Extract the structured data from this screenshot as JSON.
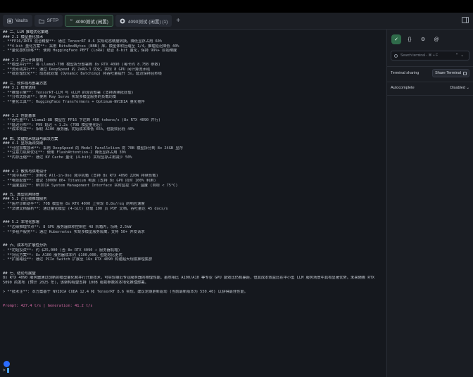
{
  "tabs": [
    {
      "label": "Vaults",
      "icon": "vault-icon"
    },
    {
      "label": "SFTP",
      "icon": "folder-icon"
    },
    {
      "label": "4090测试 (闲置)",
      "icon": "server-icon",
      "active": true
    },
    {
      "label": "4090测试 (闲置) (1)",
      "icon": "server-icon"
    }
  ],
  "terminal": {
    "lines": [
      {
        "t": "## 二、LLM 推理优化策略",
        "c": "h2"
      },
      {
        "t": "### 2.1 模型量化技术",
        "c": "h3"
      },
      {
        "t": "- **FP16/INT8 混合精度**: 通过 TensorRT 8.6 实现动态精度转换，降低显存占用 60%"
      },
      {
        "t": "- **4-bit 量化方案**: 采用 BitsAndBytes (BNB) 库，模型体积压缩至 1/4，推理延迟降低 40%"
      },
      {
        "t": "- **量化感知训练**: 使用 HuggingFace PEFT (LoRA) 结合 8-bit 量化，保持 99%+ 原始精度"
      },
      {
        "t": "",
        "c": "blank"
      },
      {
        "t": "### 2.2 并行计算架构",
        "c": "h3"
      },
      {
        "t": "- **模型并行**: 将 Llama3-70B 模型拆分部署到 8x RTX 4090 (每卡约 8.75B 参数)"
      },
      {
        "t": "- **流水线并行**: 通过 DeepSpeed 的 ZeRO-3 优化，实现 8 GPU 间计算流水线"
      },
      {
        "t": "- **批处理优化**: 动态批处理 (Dynamic Batching) 将吞吐量提升 3x，延迟保持且秒级"
      },
      {
        "t": "",
        "c": "blank"
      },
      {
        "t": "## 三、软件栈与部署方案",
        "c": "h2"
      },
      {
        "t": "### 3.1 框架选择",
        "c": "h3"
      },
      {
        "t": "- **推理引擎**: TensorRT-LLM 与 vLLM 的混合部署 (支持连续批处理)"
      },
      {
        "t": "- **分布式协调**: 使用 Ray Serve 实现多模型服务的负载均衡"
      },
      {
        "t": "- **量化工具**: HuggingFace Transformers + Optimum-NVIDIA 量化插件"
      },
      {
        "t": "",
        "c": "blank"
      },
      {
        "t": "",
        "c": "blank"
      },
      {
        "t": "### 3.2 性能基准",
        "c": "h3"
      },
      {
        "t": "- **吞吐量**: Llama3-8B 模型在 FP16 下达到 450 tokens/s (8x RTX 4090 并行)"
      },
      {
        "t": "- **延迟分布**: P99 延迟 < 1.2s (70B 模型量化后)"
      },
      {
        "t": "- **成本效益**: 相较 A100 服务器，初始成本降低 65%，但能效比低 40%"
      },
      {
        "t": "",
        "c": "blank"
      },
      {
        "t": "## 四、关键技术挑战与解决方案",
        "c": "h2"
      },
      {
        "t": "### 4.1 显存瓶颈突破",
        "c": "h3"
      },
      {
        "t": "- **分层加载技术**: 采用 DeepSpeed 的 Model Parallelism 将 70B 模型拆分到 8x 24GB 显存"
      },
      {
        "t": "- **注意力机制优化**: 使用 FlashAttention-2 降低显存占用 30%"
      },
      {
        "t": "- **内存压缩**: 通过 KV Cache 量化 (4-bit) 实现显存占用减少 50%"
      },
      {
        "t": "",
        "c": "blank"
      },
      {
        "t": "",
        "c": "blank"
      },
      {
        "t": "### 4.2 散热与供电设计",
        "c": "h3"
      },
      {
        "t": "- **液冷系统**: 定制化 All-in-One 液冷机箱 (支持 8x RTX 4090 220W 持续负载)"
      },
      {
        "t": "- **电源配置**: 建议 3000W 80+ Titanium 电源 (支持 8x GPU 同时 100% 利用)"
      },
      {
        "t": "- **温度监控**: NVIDIA System Management Interface 实时监控 GPU 温度 (目标 < 75°C)"
      },
      {
        "t": "",
        "c": "blank"
      },
      {
        "t": "## 五、典型应用场景",
        "c": "h2"
      },
      {
        "t": "### 5.1 企业级推理服务",
        "c": "h3"
      },
      {
        "t": "- **医疗诊断助手**: 70B 模型在 8x RTX 4090 上实现 0.8s/req 的响应速度"
      },
      {
        "t": "- **法律文档解析**: 通过量化模型 (4-bit) 处理 100 页 PDF 文档，吞吐量达 45 docs/s"
      },
      {
        "t": "",
        "c": "blank"
      },
      {
        "t": "",
        "c": "blank"
      },
      {
        "t": "### 5.2 本地化部署",
        "c": "h3"
      },
      {
        "t": "- **边缘推理节点**: 8 GPU 服务器体积控制在 4U 机箱内，功耗 2.5kW"
      },
      {
        "t": "- **多租户服务**: 通过 Kubernetes 实现多模型服务隔离，支持 50+ 并发请求"
      },
      {
        "t": "",
        "c": "blank"
      },
      {
        "t": "",
        "c": "blank"
      },
      {
        "t": "## 六、成本与扩展性分析",
        "c": "h2"
      },
      {
        "t": "- **初始投资**: 约 $25,000 (含 8x RTX 4090 + 服务器机箱)"
      },
      {
        "t": "- **对比方案**: 8x A100 服务器成本约 $100,000，但能效比更优"
      },
      {
        "t": "- **扩展路径**: 通过 PCIe Switch 扩展至 16x RTX 4090 构建超大规模推理集群"
      },
      {
        "t": "",
        "c": "blank"
      },
      {
        "t": "",
        "c": "blank"
      },
      {
        "t": "## 七、结论与展望",
        "c": "h2"
      }
    ],
    "conclusion": "8x RTX 4090 服务器通过创新的模型量化和并行计算技术，可实现接近专业服务器的推理性能。虽然相比 A100/A10 等专业 GPU 能效比仍有差距，但其成本效益比在中小型 LLM 服务场景中具有显著优势。未来随着 RTX 5090 的发布 (预计 2025 年)，该架构有望支持 100B 级别参数的本地化推理部署。",
    "note": "> **技术注**: 本方案基于 NVIDIA CUDA 12.4 和 TensorRT 8.6 实现，建议定期更新驱动 (当前最新版本为 550.40) 以获得最佳性能。",
    "stats": "Prompt: 427.4 t/s | Generation: 41.2 t/s",
    "prompt_symbol": ">"
  },
  "sidebar": {
    "icons": [
      "assistant-icon",
      "code-icon",
      "gear-icon",
      "at-icon"
    ],
    "icon_glyphs": [
      "✓",
      "{}",
      "⚙",
      "@"
    ],
    "search_placeholder": "Search terminal - ⌘ + F",
    "terminal_sharing_label": "Terminal sharing",
    "share_button_label": "Share Terminal",
    "autocomplete_label": "Autocomplete",
    "autocomplete_value": "Disabled"
  },
  "colors": {
    "accent": "#2f6b4a",
    "stats": "#d76aa5",
    "caret": "#4aa3ff"
  }
}
